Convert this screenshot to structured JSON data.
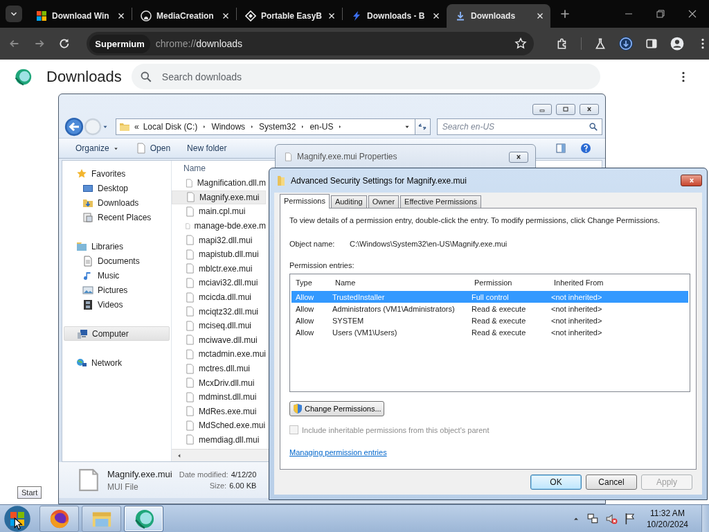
{
  "browser": {
    "tabs": [
      {
        "title": "Download Win",
        "selected": false
      },
      {
        "title": "MediaCreation",
        "selected": false
      },
      {
        "title": "Portable EasyB",
        "selected": false
      },
      {
        "title": "Downloads - B",
        "selected": false
      },
      {
        "title": "Downloads",
        "selected": true
      }
    ],
    "omnibox": {
      "badge": "Supermium",
      "scheme": "chrome://",
      "path": "downloads"
    }
  },
  "page": {
    "title": "Downloads",
    "search": {
      "placeholder": "Search downloads"
    }
  },
  "explorer": {
    "path_overflow": "«",
    "path": [
      "Local Disk (C:)",
      "Windows",
      "System32",
      "en-US"
    ],
    "search": {
      "placeholder": "Search en-US"
    },
    "commands": [
      {
        "label": "Organize",
        "kind": "menu"
      },
      {
        "label": "Open",
        "kind": "file"
      },
      {
        "label": "New folder",
        "kind": "plain"
      }
    ],
    "navigation": [
      {
        "label": "Favorites",
        "selected": false,
        "children": [
          {
            "label": "Desktop",
            "selected": false
          },
          {
            "label": "Downloads",
            "selected": false
          },
          {
            "label": "Recent Places",
            "selected": false
          }
        ]
      },
      {
        "label": "Libraries",
        "selected": false,
        "children": [
          {
            "label": "Documents",
            "selected": false
          },
          {
            "label": "Music",
            "selected": false
          },
          {
            "label": "Pictures",
            "selected": false
          },
          {
            "label": "Videos",
            "selected": false
          }
        ]
      },
      {
        "label": "Computer",
        "selected": true
      },
      {
        "label": "Network",
        "selected": false
      }
    ],
    "column": "Name",
    "files": [
      {
        "name": "Magnification.dll.m",
        "selected": false
      },
      {
        "name": "Magnify.exe.mui",
        "selected": true
      },
      {
        "name": "main.cpl.mui",
        "selected": false
      },
      {
        "name": "manage-bde.exe.m",
        "selected": false
      },
      {
        "name": "mapi32.dll.mui",
        "selected": false
      },
      {
        "name": "mapistub.dll.mui",
        "selected": false
      },
      {
        "name": "mblctr.exe.mui",
        "selected": false
      },
      {
        "name": "mciavi32.dll.mui",
        "selected": false
      },
      {
        "name": "mcicda.dll.mui",
        "selected": false
      },
      {
        "name": "mciqtz32.dll.mui",
        "selected": false
      },
      {
        "name": "mciseq.dll.mui",
        "selected": false
      },
      {
        "name": "mciwave.dll.mui",
        "selected": false
      },
      {
        "name": "mctadmin.exe.mui",
        "selected": false
      },
      {
        "name": "mctres.dll.mui",
        "selected": false
      },
      {
        "name": "McxDriv.dll.mui",
        "selected": false
      },
      {
        "name": "mdminst.dll.mui",
        "selected": false
      },
      {
        "name": "MdRes.exe.mui",
        "selected": false
      },
      {
        "name": "MdSched.exe.mui",
        "selected": false
      },
      {
        "name": "memdiag.dll.mui",
        "selected": false
      }
    ],
    "details": {
      "name": "Magnify.exe.mui",
      "type": "MUI File",
      "date_label": "Date modified:",
      "date_value": "4/12/20",
      "size_label": "Size:",
      "size_value": "6.00 KB"
    }
  },
  "properties": {
    "title": "Magnify.exe.mui Properties"
  },
  "security": {
    "title": "Advanced Security Settings for Magnify.exe.mui",
    "tabs": [
      {
        "label": "Permissions",
        "selected": true
      },
      {
        "label": "Auditing",
        "selected": false
      },
      {
        "label": "Owner",
        "selected": false
      },
      {
        "label": "Effective Permissions",
        "selected": false
      }
    ],
    "intro": "To view details of a permission entry, double-click the entry. To modify permissions, click Change Permissions.",
    "object_label": "Object name:",
    "object_value": "C:\\Windows\\System32\\en-US\\Magnify.exe.mui",
    "entries_label": "Permission entries:",
    "columns": [
      "Type",
      "Name",
      "Permission",
      "Inherited From"
    ],
    "rows": [
      {
        "cells": [
          "Allow",
          "TrustedInstaller",
          "Full control",
          "<not inherited>"
        ],
        "selected": true
      },
      {
        "cells": [
          "Allow",
          "Administrators (VM1\\Administrators)",
          "Read & execute",
          "<not inherited>"
        ],
        "selected": false
      },
      {
        "cells": [
          "Allow",
          "SYSTEM",
          "Read & execute",
          "<not inherited>"
        ],
        "selected": false
      },
      {
        "cells": [
          "Allow",
          "Users (VM1\\Users)",
          "Read & execute",
          "<not inherited>"
        ],
        "selected": false
      }
    ],
    "change_button": "Change Permissions...",
    "inherit": {
      "label": "Include inheritable permissions from this object's parent",
      "checked": false,
      "disabled": true
    },
    "help_link": "Managing permission entries",
    "buttons": [
      {
        "label": "OK",
        "kind": "default"
      },
      {
        "label": "Cancel",
        "kind": "normal"
      },
      {
        "label": "Apply",
        "kind": "disabled"
      }
    ]
  },
  "taskbar": {
    "tooltip": "Start",
    "apps": [
      {
        "active": false
      },
      {
        "active": false
      },
      {
        "active": true
      }
    ],
    "clock": {
      "time": "11:32 AM",
      "date": "10/20/2024"
    }
  }
}
